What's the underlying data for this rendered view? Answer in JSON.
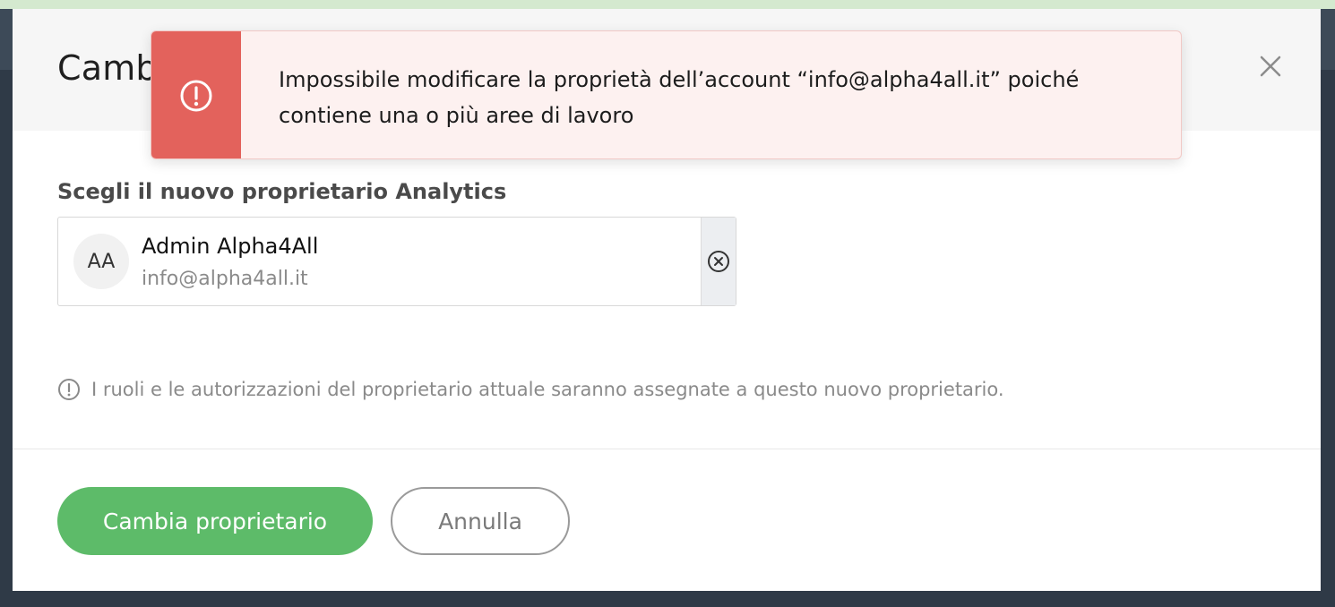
{
  "modal": {
    "title": "Camb",
    "section_label": "Scegli il nuovo proprietario Analytics",
    "selected_owner": {
      "initials": "AA",
      "name": "Admin Alpha4All",
      "email": "info@alpha4all.it"
    },
    "info_text": "I ruoli e le autorizzazioni del proprietario attuale saranno assegnate a questo nuovo proprietario.",
    "primary_button": "Cambia proprietario",
    "secondary_button": "Annulla"
  },
  "toast": {
    "type": "error",
    "message": "Impossibile modificare la proprietà dell’account “info@alpha4all.it” poiché contiene una o più aree di lavoro"
  },
  "icons": {
    "close": "close-icon",
    "toast": "exclamation-circle-icon",
    "clear": "clear-circle-icon",
    "info": "info-circle-icon"
  },
  "colors": {
    "primary_button": "#5dbb69",
    "toast_band": "#e3625c",
    "toast_background": "#fdf1f0"
  }
}
